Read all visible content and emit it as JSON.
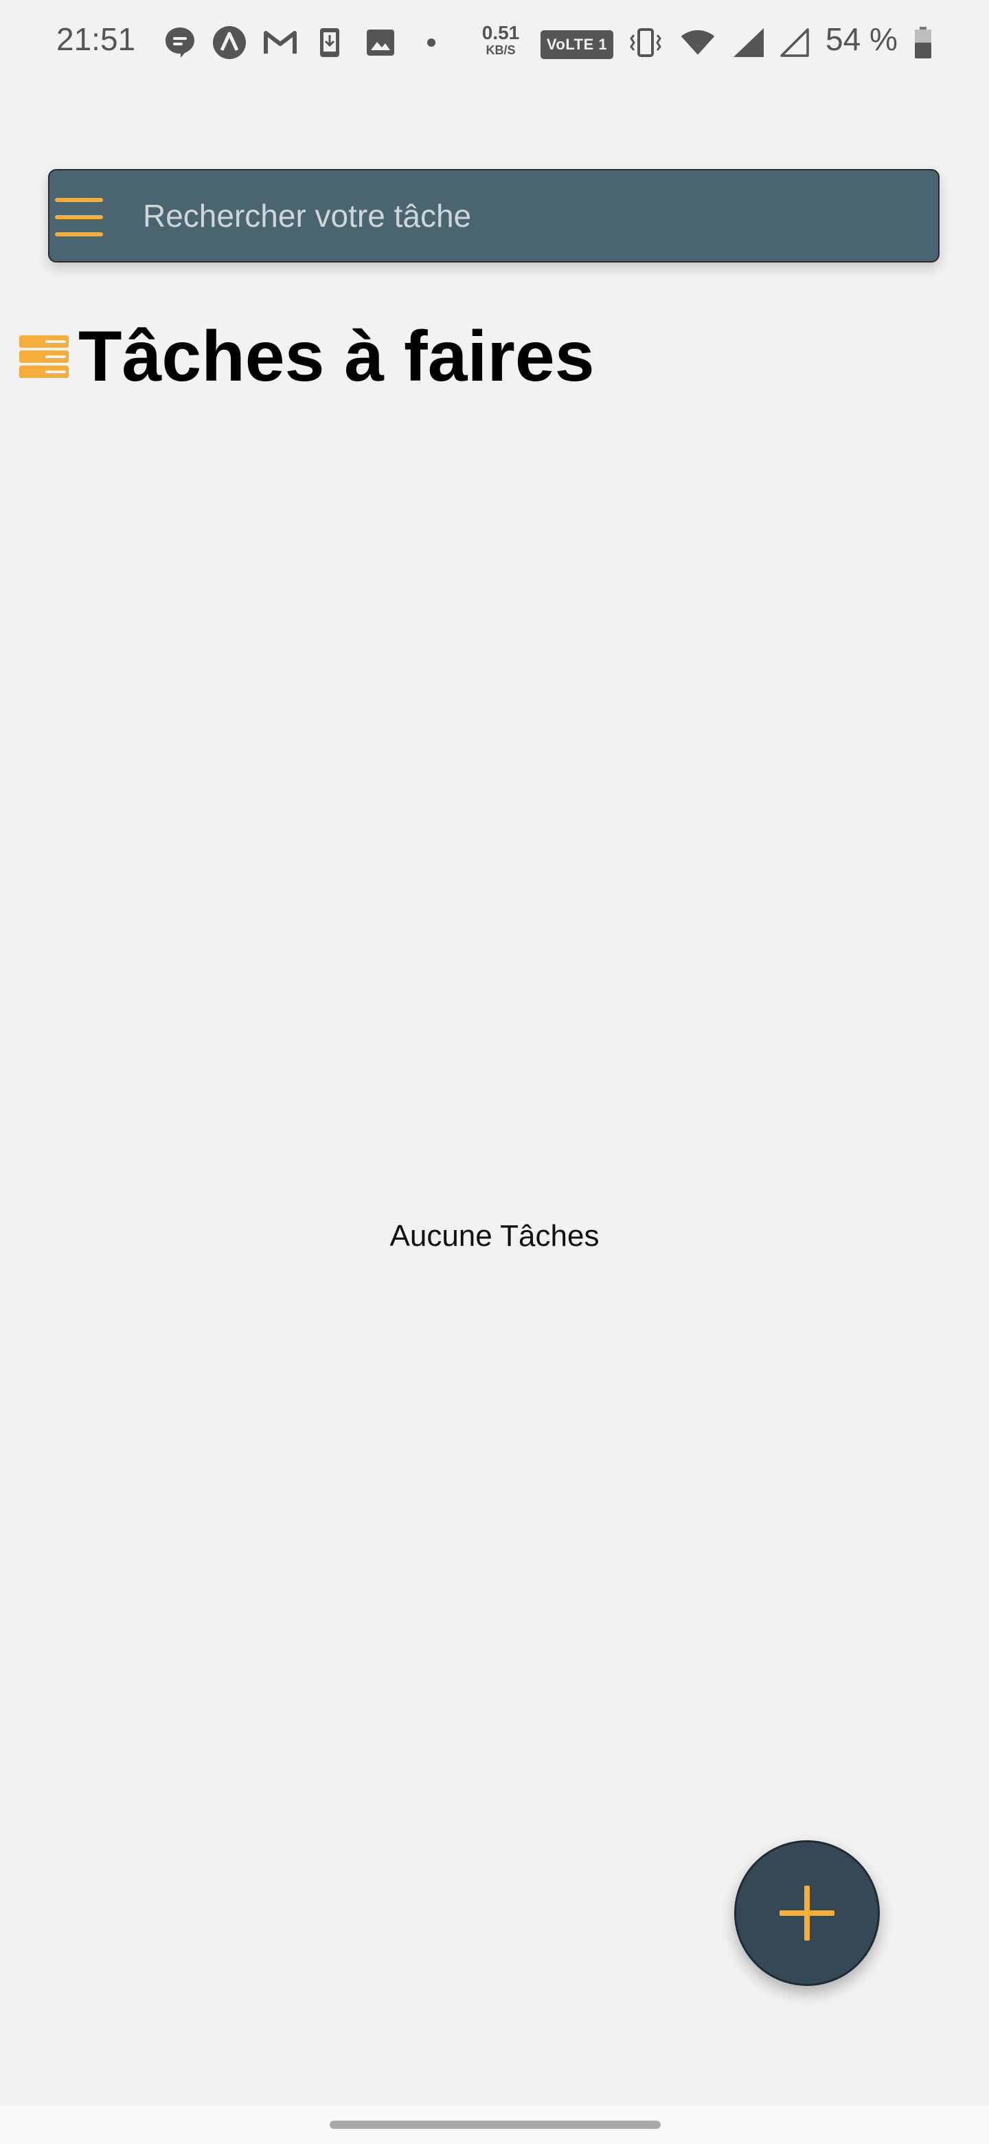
{
  "status_bar": {
    "time": "21:51",
    "network_speed_value": "0.51",
    "network_speed_unit": "KB/S",
    "volte_label": "VoLTE 1",
    "battery_percent": "54 %",
    "icons": [
      "messages-icon",
      "app-a-icon",
      "gmail-icon",
      "download-icon",
      "gallery-icon",
      "notification-dot-icon",
      "vibrate-icon",
      "wifi-icon",
      "signal-icon",
      "signal-empty-icon",
      "battery-icon"
    ]
  },
  "search": {
    "placeholder": "Rechercher votre tâche",
    "value": ""
  },
  "header": {
    "title": "Tâches à faires"
  },
  "main": {
    "empty_message": "Aucune Tâches"
  },
  "colors": {
    "accent": "#f5ad3c",
    "search_bar_bg": "#4a6570",
    "fab_bg": "#354856",
    "page_bg": "#f2f2f2"
  }
}
